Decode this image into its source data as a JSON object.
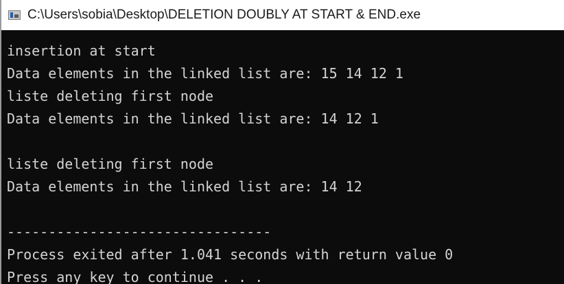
{
  "window": {
    "title": "C:\\Users\\sobia\\Desktop\\DELETION DOUBLY AT START & END.exe",
    "icon": "console-app-icon"
  },
  "console": {
    "lines": [
      "insertion at start",
      "Data elements in the linked list are: 15 14 12 1",
      "liste deleting first node",
      "Data elements in the linked list are: 14 12 1",
      "",
      "liste deleting first node",
      "Data elements in the linked list are: 14 12",
      "",
      "--------------------------------",
      "Process exited after 1.041 seconds with return value 0",
      "Press any key to continue . . ."
    ]
  },
  "colors": {
    "console_background": "#0c0c0c",
    "console_text": "#d4d4d4",
    "title_bar_background": "#ffffff"
  }
}
